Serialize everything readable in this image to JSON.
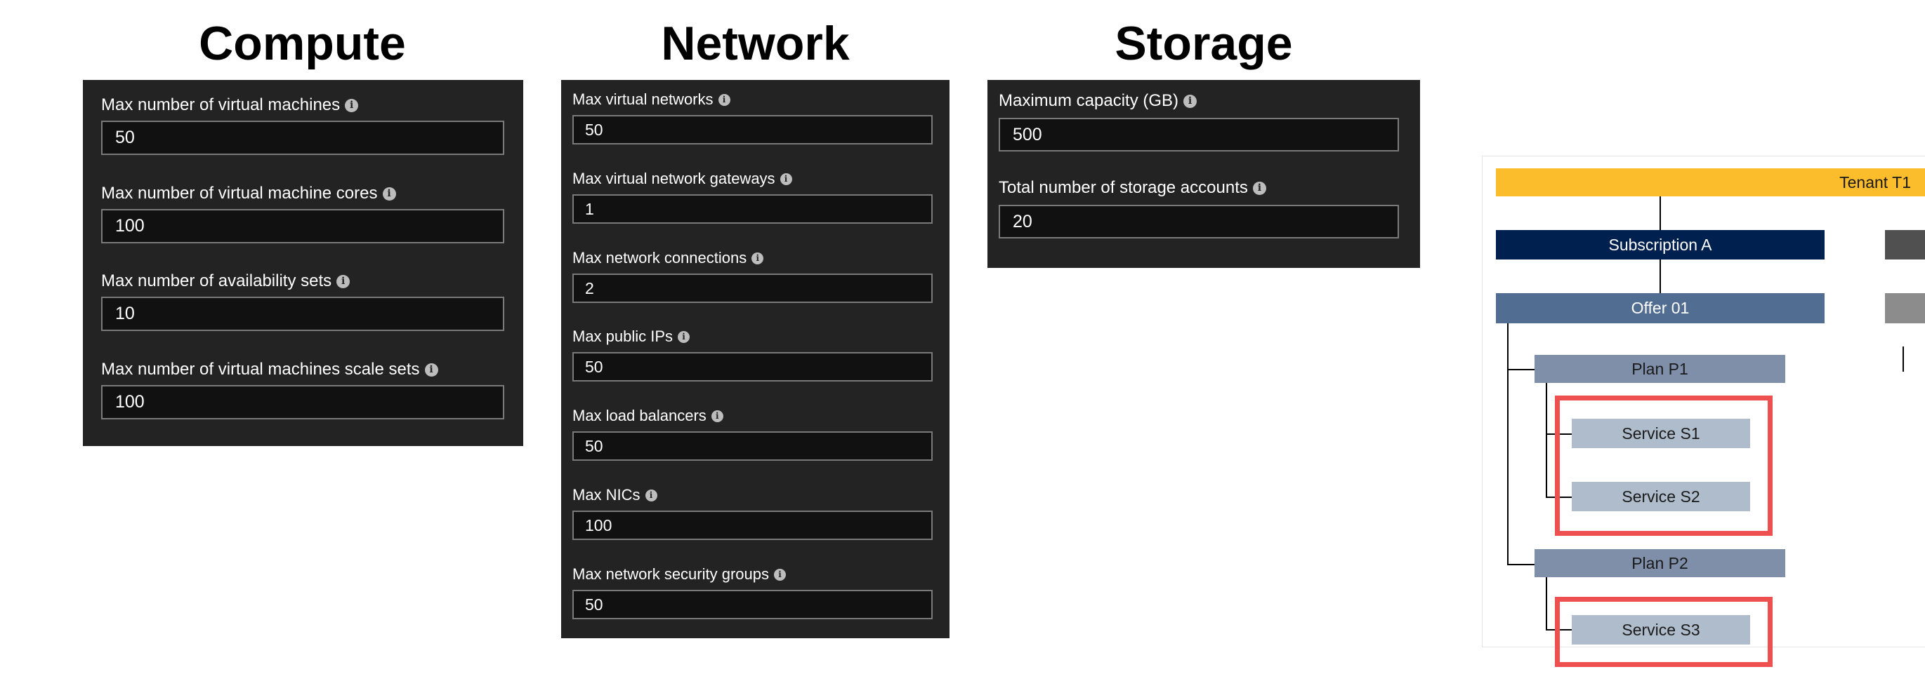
{
  "headings": {
    "compute": "Compute",
    "network": "Network",
    "storage": "Storage"
  },
  "compute": {
    "fields": [
      {
        "label": "Max number of virtual machines",
        "value": "50"
      },
      {
        "label": "Max number of virtual machine cores",
        "value": "100"
      },
      {
        "label": "Max number of availability sets",
        "value": "10"
      },
      {
        "label": "Max number of virtual machines scale sets",
        "value": "100"
      }
    ]
  },
  "network": {
    "fields": [
      {
        "label": "Max virtual networks",
        "value": "50"
      },
      {
        "label": "Max virtual network gateways",
        "value": "1"
      },
      {
        "label": "Max network connections",
        "value": "2"
      },
      {
        "label": "Max public IPs",
        "value": "50"
      },
      {
        "label": "Max load balancers",
        "value": "50"
      },
      {
        "label": "Max NICs",
        "value": "100"
      },
      {
        "label": "Max network security groups",
        "value": "50"
      }
    ]
  },
  "storage": {
    "fields": [
      {
        "label": "Maximum capacity (GB)",
        "value": "500"
      },
      {
        "label": "Total number of storage accounts",
        "value": "20"
      }
    ]
  },
  "info_icon_glyph": "i",
  "diagram": {
    "tenant": "Tenant T1",
    "subscription": "Subscription A",
    "offer": "Offer 01",
    "plans": [
      {
        "label": "Plan P1",
        "services": [
          "Service S1",
          "Service S2"
        ]
      },
      {
        "label": "Plan P2",
        "services": [
          "Service S3"
        ]
      }
    ]
  },
  "colors": {
    "panel_bg": "#232323",
    "tenant": "#fbbd2b",
    "subscription": "#002050",
    "offer": "#526d92",
    "plan": "#7f8faa",
    "service": "#afbccc",
    "highlight": "#ee5050"
  }
}
